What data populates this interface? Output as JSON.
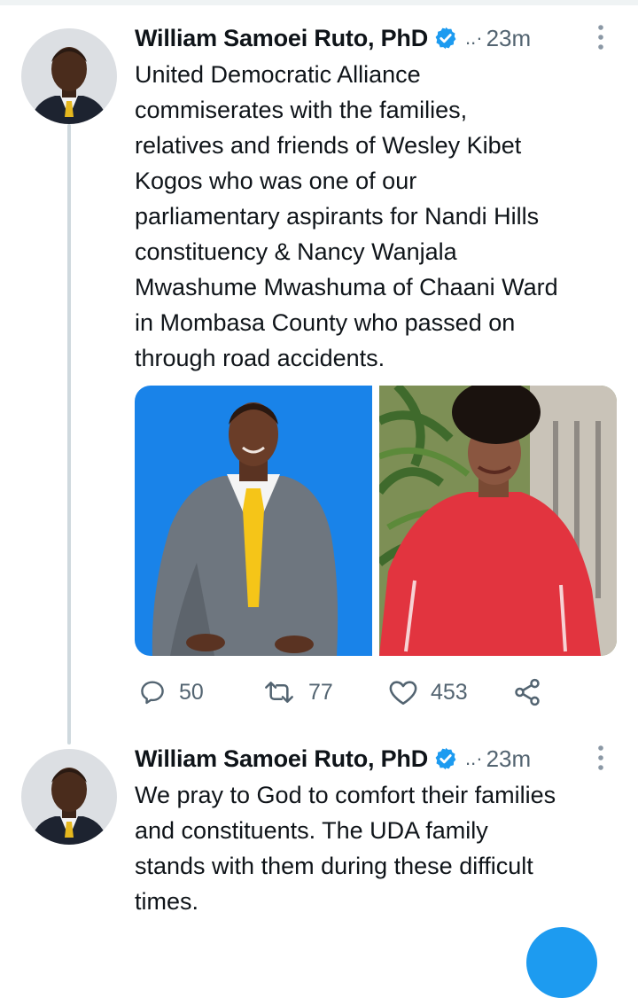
{
  "tweets": [
    {
      "author": "William Samoei Ruto, PhD",
      "separator": "..·",
      "time": "23m",
      "lines": [
        "United Democratic Alliance",
        "commiserates with the families,",
        "relatives and friends of Wesley Kibet",
        "Kogos who was one of our",
        "parliamentary aspirants for Nandi Hills",
        "constituency & Nancy Wanjala",
        "Mwashume Mwashuma of Chaani Ward",
        "in Mombasa County who passed on",
        "through road accidents."
      ],
      "stats": {
        "replies": "50",
        "retweets": "77",
        "likes": "453"
      }
    },
    {
      "author": "William Samoei Ruto, PhD",
      "separator": "..·",
      "time": "23m",
      "lines": [
        "We pray to God to comfort their families",
        "and constituents. The UDA family",
        "stands with them during these difficult",
        "times."
      ]
    }
  ],
  "icons": {
    "verified": "verified-badge-icon",
    "more": "vertical-dots-icon",
    "reply": "reply-icon",
    "retweet": "retweet-icon",
    "like": "heart-icon",
    "share": "share-icon"
  },
  "colors": {
    "accent": "#1d9bf0",
    "muted": "#536471",
    "text": "#0f1419"
  }
}
